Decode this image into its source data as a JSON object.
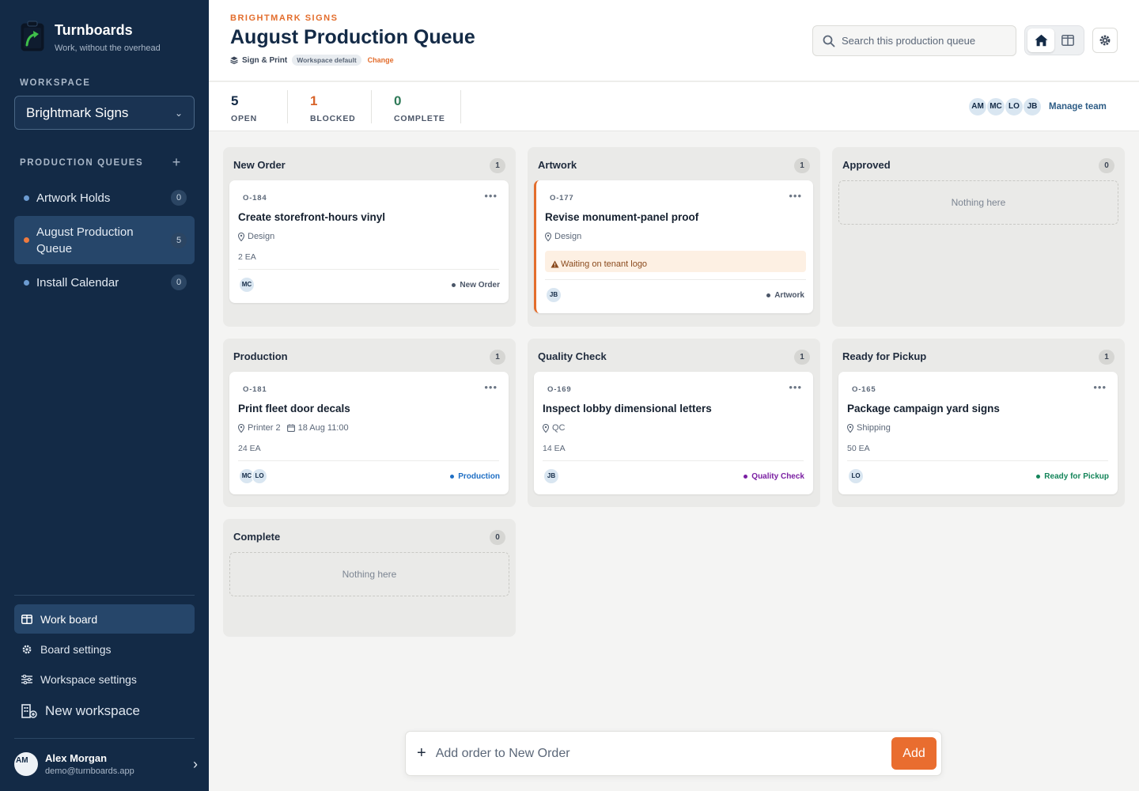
{
  "app": {
    "name": "Turnboards",
    "tagline": "Work, without the overhead"
  },
  "sidebar": {
    "workspace_heading": "WORKSPACE",
    "workspace_selected": "Brightmark Signs",
    "queues_heading": "PRODUCTION QUEUES",
    "queues": [
      {
        "label": "Artwork Holds",
        "count": "0"
      },
      {
        "label": "August Production Queue",
        "count": "5"
      },
      {
        "label": "Install Calendar",
        "count": "0"
      }
    ],
    "nav": [
      {
        "label": "Work board",
        "icon": "board-icon"
      },
      {
        "label": "Board settings",
        "icon": "gear-icon"
      },
      {
        "label": "Workspace settings",
        "icon": "sliders-icon"
      },
      {
        "label": "New workspace",
        "icon": "building-add-icon"
      }
    ],
    "user": {
      "initials": "AM",
      "name": "Alex Morgan",
      "email": "demo@turnboards.app"
    }
  },
  "header": {
    "eyebrow": "BRIGHTMARK SIGNS",
    "title": "August Production Queue",
    "type_label": "Sign & Print",
    "type_badge": "Workspace default",
    "change_link": "Change",
    "search_placeholder": "Search this production queue"
  },
  "stats": {
    "open": {
      "value": "5",
      "label": "OPEN",
      "color": "#132a46"
    },
    "blocked": {
      "value": "1",
      "label": "BLOCKED",
      "color": "#d8642a"
    },
    "complete": {
      "value": "0",
      "label": "COMPLETE",
      "color": "#2f7a58"
    },
    "team": [
      "AM",
      "MC",
      "LO",
      "JB"
    ],
    "manage_team": "Manage team"
  },
  "columns": {
    "new_order": {
      "title": "New Order",
      "count": "1",
      "card": {
        "id": "O-184",
        "title": "Create storefront-hours vinyl",
        "location": "Design",
        "qty": "2 EA",
        "assignees": [
          "MC"
        ],
        "status": "New Order",
        "status_color": "#4b5668"
      }
    },
    "artwork": {
      "title": "Artwork",
      "count": "1",
      "card": {
        "id": "O-177",
        "title": "Revise monument-panel proof",
        "location": "Design",
        "alert": "Waiting on tenant logo",
        "assignees": [
          "JB"
        ],
        "status": "Artwork",
        "status_color": "#4b5668"
      }
    },
    "approved": {
      "title": "Approved",
      "count": "0",
      "empty": "Nothing here"
    },
    "production": {
      "title": "Production",
      "count": "1",
      "card": {
        "id": "O-181",
        "title": "Print fleet door decals",
        "location": "Printer 2",
        "due": "18 Aug 11:00",
        "qty": "24 EA",
        "assignees": [
          "MC",
          "LO"
        ],
        "status": "Production",
        "status_color": "#1f6fc4"
      }
    },
    "quality_check": {
      "title": "Quality Check",
      "count": "1",
      "card": {
        "id": "O-169",
        "title": "Inspect lobby dimensional letters",
        "location": "QC",
        "qty": "14 EA",
        "assignees": [
          "JB"
        ],
        "status": "Quality Check",
        "status_color": "#7a1fa2"
      }
    },
    "ready_pickup": {
      "title": "Ready for Pickup",
      "count": "1",
      "card": {
        "id": "O-165",
        "title": "Package campaign yard signs",
        "location": "Shipping",
        "qty": "50 EA",
        "assignees": [
          "LO"
        ],
        "status": "Ready for Pickup",
        "status_color": "#14855a"
      }
    },
    "complete": {
      "title": "Complete",
      "count": "0",
      "empty": "Nothing here"
    }
  },
  "add_order": {
    "placeholder": "Add order to New Order",
    "button": "Add"
  }
}
